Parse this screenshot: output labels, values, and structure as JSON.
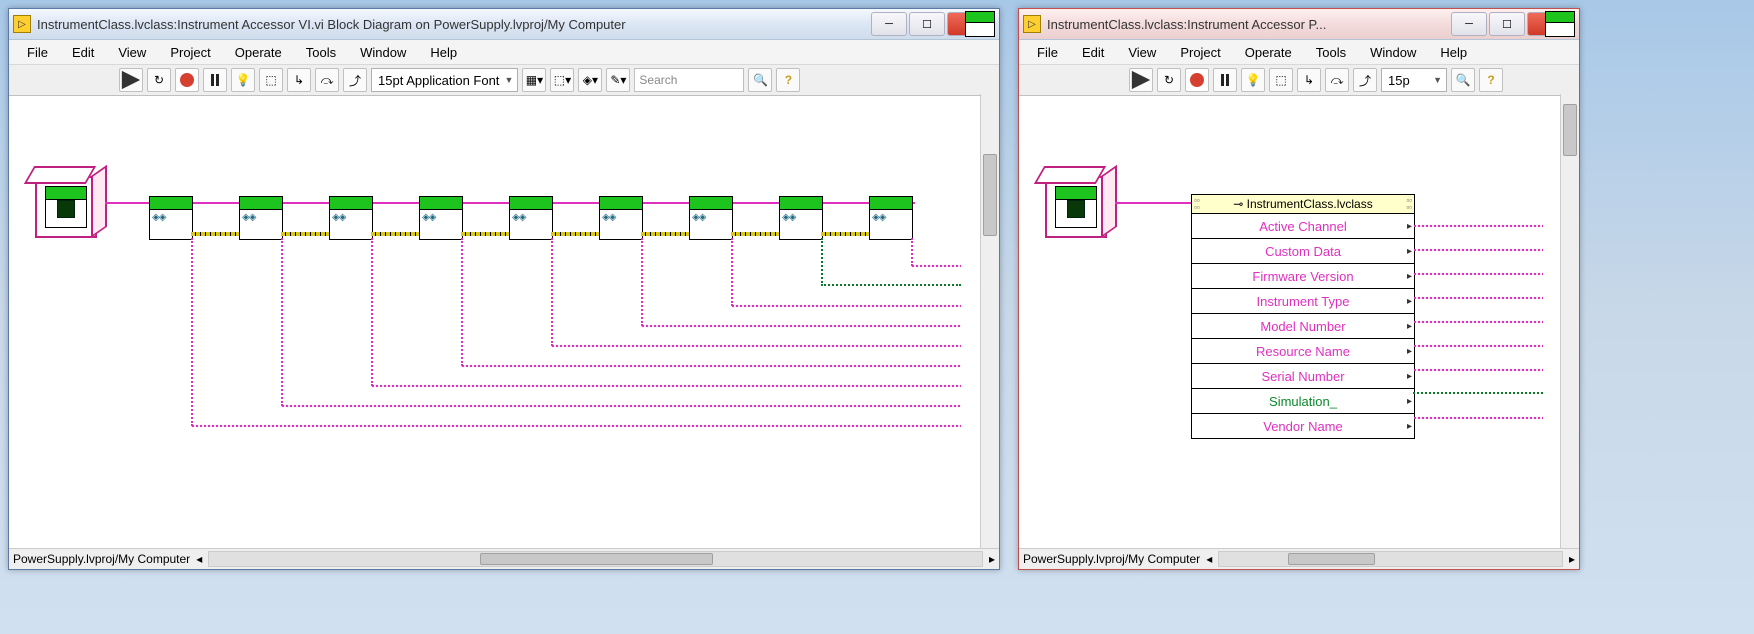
{
  "left_window": {
    "title": "InstrumentClass.lvclass:Instrument Accessor VI.vi Block Diagram on PowerSupply.lvproj/My Computer",
    "menus": [
      "File",
      "Edit",
      "View",
      "Project",
      "Operate",
      "Tools",
      "Window",
      "Help"
    ],
    "font_selector": "15pt Application Font",
    "search_placeholder": "Search",
    "status_path": "PowerSupply.lvproj/My Computer"
  },
  "right_window": {
    "title": "InstrumentClass.lvclass:Instrument Accessor P...",
    "menus": [
      "File",
      "Edit",
      "View",
      "Project",
      "Operate",
      "Tools",
      "Window",
      "Help"
    ],
    "font_selector": "15p",
    "status_path": "PowerSupply.lvproj/My Computer",
    "unbundle": {
      "class_label": "InstrumentClass.lvclass",
      "items": [
        {
          "label": "Active Channel",
          "style": "pink"
        },
        {
          "label": "Custom Data",
          "style": "pink"
        },
        {
          "label": "Firmware Version",
          "style": "pink"
        },
        {
          "label": "Instrument Type",
          "style": "pink"
        },
        {
          "label": "Model Number",
          "style": "pink"
        },
        {
          "label": "Resource Name",
          "style": "pink"
        },
        {
          "label": "Serial Number",
          "style": "pink"
        },
        {
          "label": "Simulation_",
          "style": "green"
        },
        {
          "label": "Vendor Name",
          "style": "pink"
        }
      ]
    }
  }
}
